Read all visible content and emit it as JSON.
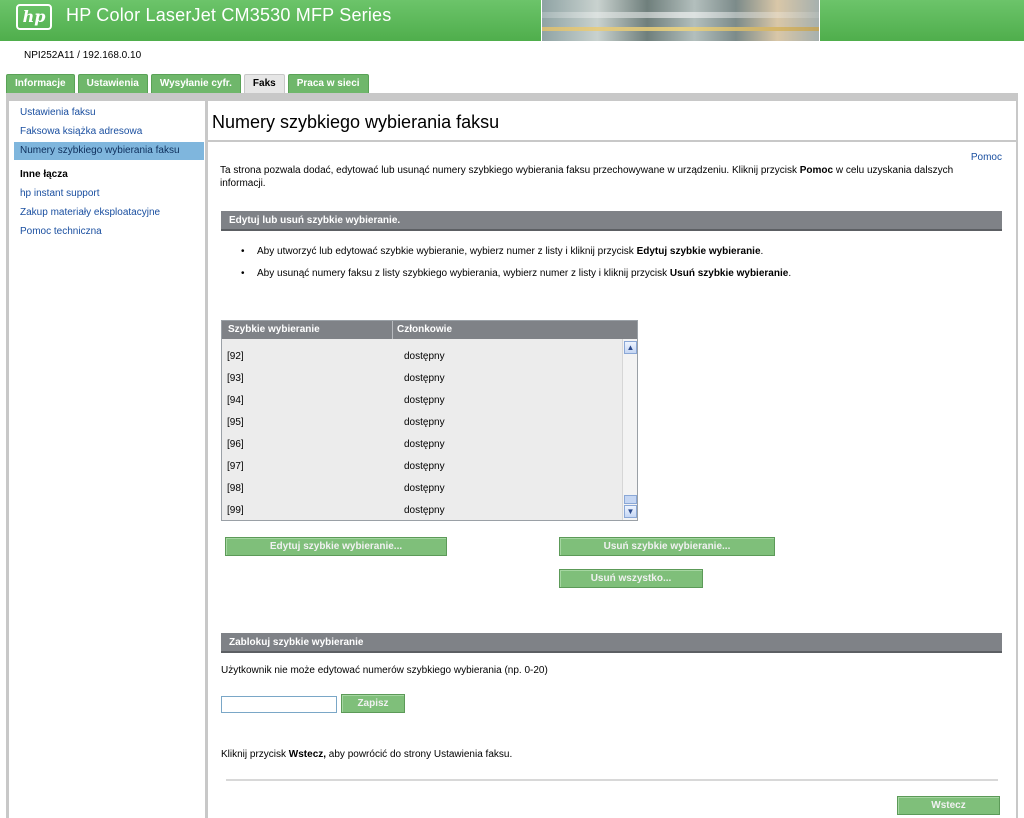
{
  "header": {
    "logo_text": "hp",
    "title": "HP Color LaserJet CM3530 MFP Series",
    "device": "NPI252A11 / 192.168.0.10"
  },
  "tabs": [
    "Informacje",
    "Ustawienia",
    "Wysyłanie cyfr.",
    "Faks",
    "Praca w sieci"
  ],
  "active_tab": "Faks",
  "sidebar": {
    "items": [
      "Ustawienia faksu",
      "Faksowa książka adresowa",
      "Numery szybkiego wybierania faksu"
    ],
    "selected": "Numery szybkiego wybierania faksu",
    "other_heading": "Inne łącza",
    "links": [
      "hp instant support",
      "Zakup materiały eksploatacyjne",
      "Pomoc techniczna"
    ]
  },
  "main": {
    "title": "Numery szybkiego wybierania faksu",
    "help_link": "Pomoc",
    "intro_text": "Ta strona pozwala dodać, edytować lub usunąć numery szybkiego wybierania faksu przechowywane w urządzeniu. Kliknij przycisk ",
    "intro_bold": "Pomoc",
    "intro_tail": " w celu uzyskania dalszych informacji.",
    "section1": "Edytuj lub usuń szybkie wybieranie.",
    "bullet1_text": "Aby utworzyć lub edytować szybkie wybieranie, wybierz numer z listy i kliknij przycisk ",
    "bullet1_bold": "Edytuj szybkie wybieranie",
    "bullet2_text": "Aby usunąć numery faksu z listy szybkiego wybierania, wybierz numer z listy i kliknij przycisk ",
    "bullet2_bold": "Usuń szybkie wybieranie",
    "period": ".",
    "list": {
      "col1": "Szybkie wybieranie",
      "col2": "Członkowie",
      "rows": [
        {
          "num": "[92]",
          "members": "dostępny"
        },
        {
          "num": "[93]",
          "members": "dostępny"
        },
        {
          "num": "[94]",
          "members": "dostępny"
        },
        {
          "num": "[95]",
          "members": "dostępny"
        },
        {
          "num": "[96]",
          "members": "dostępny"
        },
        {
          "num": "[97]",
          "members": "dostępny"
        },
        {
          "num": "[98]",
          "members": "dostępny"
        },
        {
          "num": "[99]",
          "members": "dostępny"
        }
      ]
    },
    "btn_edit": "Edytuj szybkie wybieranie...",
    "btn_delete": "Usuń szybkie wybieranie...",
    "btn_delete_all": "Usuń wszystko...",
    "section2": "Zablokuj szybkie wybieranie",
    "lock_text": "Użytkownik nie może edytować numerów szybkiego wybierania (np. 0-20)",
    "lock_value": "",
    "btn_save": "Zapisz",
    "back_text_pre": "Kliknij przycisk ",
    "back_text_bold": "Wstecz,",
    "back_text_post": " aby powrócić do strony Ustawienia faksu.",
    "btn_back": "Wstecz"
  },
  "colors": {
    "header_green": "#5cb85c",
    "tab_green": "#6fb76b",
    "section_gray": "#7f8287",
    "link_blue": "#1a4fa0",
    "selected_blue": "#7fb6dd"
  }
}
